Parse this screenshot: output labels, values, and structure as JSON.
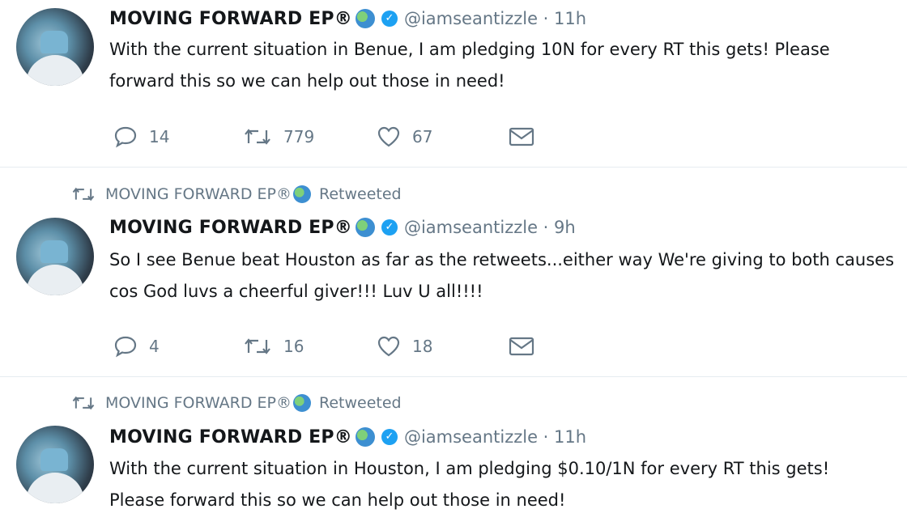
{
  "tweets": [
    {
      "retweeted_by": null,
      "name": "MOVING FORWARD EP®",
      "handle": "@iamseantizzle · 11h",
      "text": "With the current situation in Benue, I am pledging 10N for every RT this gets! Please forward this so we can help out those in need!",
      "replies": "14",
      "retweets": "779",
      "likes": "67"
    },
    {
      "retweeted_by": {
        "name": "MOVING FORWARD EP®",
        "label": "Retweeted"
      },
      "name": "MOVING FORWARD EP®",
      "handle": "@iamseantizzle · 9h",
      "text": "So I see Benue beat Houston as far as the retweets...either way We're giving to both causes cos God luvs a cheerful giver!!! Luv U all!!!!",
      "replies": "4",
      "retweets": "16",
      "likes": "18"
    },
    {
      "retweeted_by": {
        "name": "MOVING FORWARD EP®",
        "label": "Retweeted"
      },
      "name": "MOVING FORWARD EP®",
      "handle": "@iamseantizzle · 11h",
      "text": "With the current situation in Houston, I am pledging $0.10/1N for every RT this gets! Please forward this so we can help out those in need!"
    }
  ],
  "icons": {
    "reply": "speech-bubble-icon",
    "retweet": "retweet-icon",
    "like": "heart-icon",
    "dm": "envelope-icon",
    "globe": "globe-emoji-icon",
    "verified": "verified-badge-icon"
  },
  "colors": {
    "text": "#14171a",
    "muted": "#657786",
    "verified": "#1da1f2",
    "divider": "#e6ecf0"
  }
}
